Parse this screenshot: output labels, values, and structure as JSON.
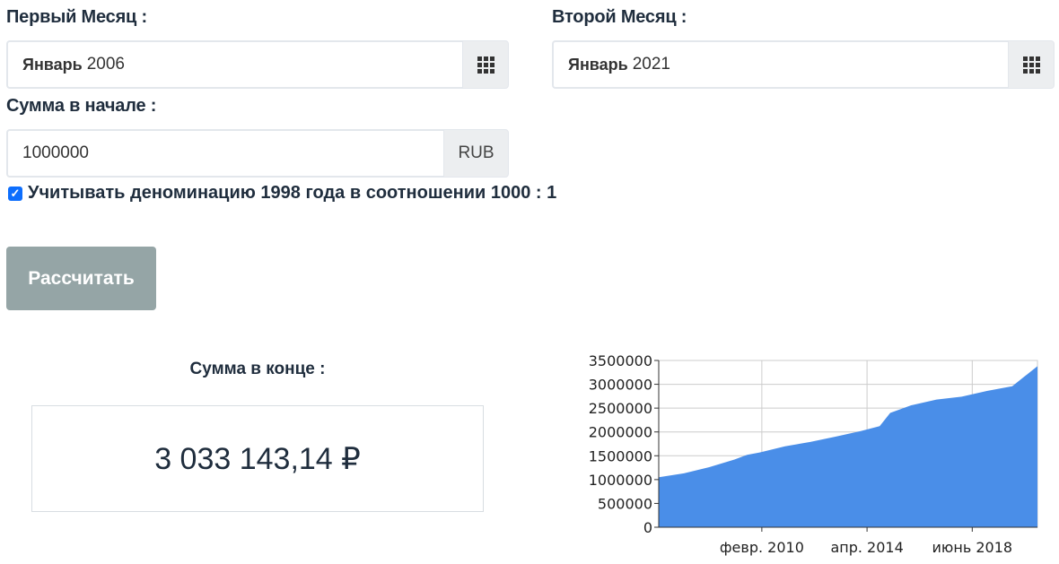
{
  "form": {
    "first_month": {
      "label": "Первый Месяц :",
      "month": "Январь",
      "year": "2006",
      "icon": "calendar-grid-icon"
    },
    "second_month": {
      "label": "Второй Месяц :",
      "month": "Январь",
      "year": "2021",
      "icon": "calendar-grid-icon"
    },
    "amount": {
      "label": "Сумма в начале :",
      "value": "1000000",
      "currency": "RUB"
    },
    "denomination": {
      "checked": true,
      "label": "Учитывать деноминацию 1998 года в соотношении 1000 : 1"
    },
    "submit_label": "Рассчитать"
  },
  "result": {
    "label": "Сумма в конце :",
    "value": "3 033 143,14 ₽"
  },
  "colors": {
    "area": "#4a8ee8",
    "button": "#95a5a6",
    "checkbox": "#0d6efd"
  },
  "chart_data": {
    "type": "area",
    "x_start": "2006-01",
    "x_end": "2021-01",
    "x_ticks": [
      {
        "date": "2010-02",
        "label": "февр. 2010"
      },
      {
        "date": "2014-04",
        "label": "апр. 2014"
      },
      {
        "date": "2018-06",
        "label": "июнь 2018"
      }
    ],
    "ylim": [
      0,
      3500000
    ],
    "y_ticks": [
      {
        "value": 0,
        "label": "0"
      },
      {
        "value": 500000,
        "label": "500000"
      },
      {
        "value": 1000000,
        "label": "1000000"
      },
      {
        "value": 1500000,
        "label": "1500000"
      },
      {
        "value": 2000000,
        "label": "2000000"
      },
      {
        "value": 2500000,
        "label": "2500000"
      },
      {
        "value": 3000000,
        "label": "3000000"
      },
      {
        "value": 3500000,
        "label": "3500000"
      }
    ],
    "grid": true,
    "series": [
      {
        "points": [
          [
            "2006-01",
            1050000
          ],
          [
            "2007-01",
            1130000
          ],
          [
            "2008-01",
            1260000
          ],
          [
            "2009-01",
            1420000
          ],
          [
            "2009-07",
            1520000
          ],
          [
            "2010-01",
            1570000
          ],
          [
            "2011-01",
            1700000
          ],
          [
            "2012-01",
            1790000
          ],
          [
            "2013-01",
            1900000
          ],
          [
            "2014-01",
            2020000
          ],
          [
            "2014-10",
            2120000
          ],
          [
            "2015-03",
            2400000
          ],
          [
            "2016-01",
            2560000
          ],
          [
            "2017-01",
            2680000
          ],
          [
            "2018-01",
            2740000
          ],
          [
            "2019-01",
            2860000
          ],
          [
            "2020-01",
            2960000
          ],
          [
            "2021-01",
            3380000
          ]
        ]
      }
    ]
  }
}
